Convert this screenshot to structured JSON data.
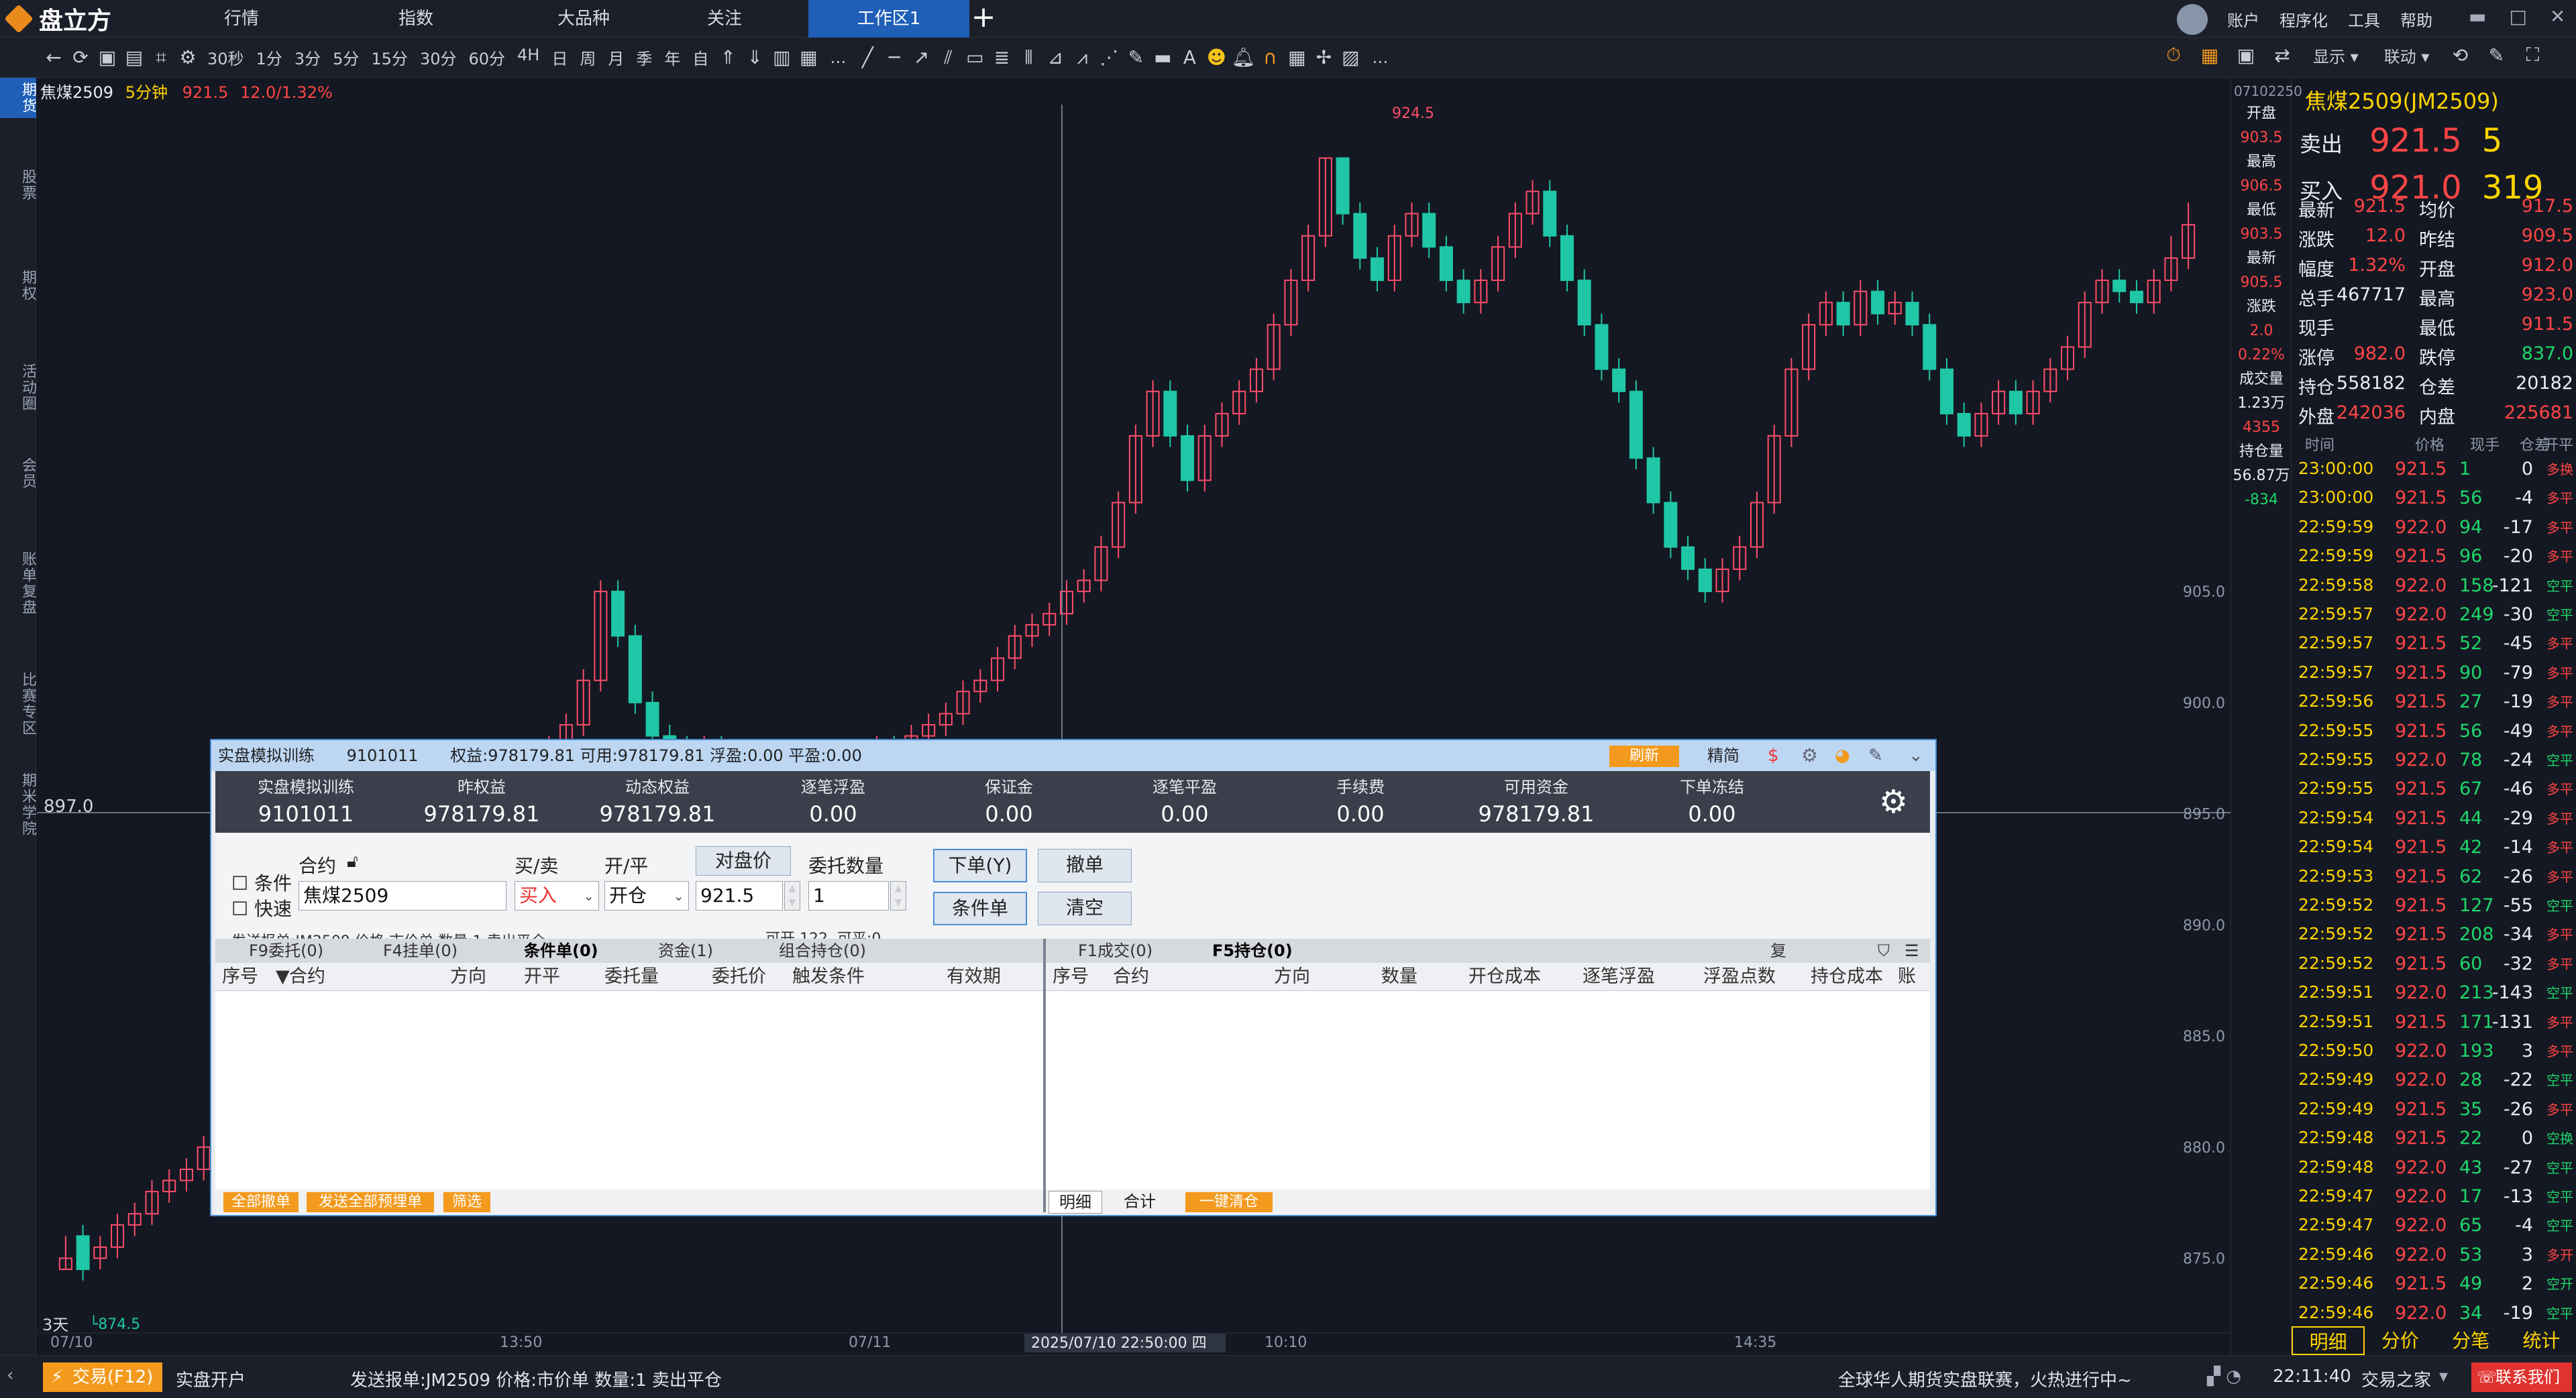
{
  "app": {
    "name": "盘立方"
  },
  "nav": {
    "tabs": [
      "行情",
      "指数",
      "大品种",
      "关注",
      "工作区1"
    ],
    "active_index": 4,
    "right_menu": [
      "账户",
      "程序化",
      "工具",
      "帮助"
    ]
  },
  "toolbar": {
    "periods": [
      "30秒",
      "1分",
      "3分",
      "5分",
      "15分",
      "30分",
      "60分",
      "4H",
      "日",
      "周",
      "月",
      "季",
      "年",
      "自"
    ],
    "right_items": [
      "显示",
      "联动"
    ]
  },
  "leftbar": {
    "items": [
      "期货",
      "股票",
      "期权",
      "活动圈",
      "会员",
      "账单复盘",
      "比赛专区",
      "期米学院"
    ],
    "active_index": 0
  },
  "chart": {
    "symbol": "焦煤2509",
    "period": "5分钟",
    "last": "921.5",
    "change": "12.0/1.32%",
    "high_label": "924.5",
    "low_label": "874.5",
    "cursor_price": "897.0",
    "cursor_time": "2025/07/10 22:50:00 四",
    "x_labels": [
      "07/10",
      "13:50",
      "07/11",
      "10:10",
      "14:35"
    ],
    "y_labels": [
      "905.0",
      "900.0",
      "895.0",
      "890.0",
      "885.0",
      "880.0",
      "875.0"
    ],
    "bottom_left": "3天",
    "side_info": [
      "开盘",
      "903.5",
      "最高",
      "906.5",
      "最低",
      "903.5",
      "最新",
      "905.5",
      "涨跌",
      "2.0",
      "0.22%",
      "成交量",
      "1.23万",
      "4355",
      "持仓量",
      "56.87万",
      "-834"
    ],
    "date_top": "07102250"
  },
  "quote": {
    "title": "焦煤2509(JM2509)",
    "sell_label": "卖出",
    "sell_price": "921.5",
    "sell_vol": "5",
    "buy_label": "买入",
    "buy_price": "921.0",
    "buy_vol": "319",
    "rows": [
      [
        "最新",
        "921.5",
        "均价",
        "917.5"
      ],
      [
        "涨跌",
        "12.0",
        "昨结",
        "909.5"
      ],
      [
        "幅度",
        "1.32%",
        "开盘",
        "912.0"
      ],
      [
        "总手",
        "467717",
        "最高",
        "923.0"
      ],
      [
        "现手",
        "",
        "最低",
        "911.5"
      ],
      [
        "涨停",
        "982.0",
        "跌停",
        "837.0"
      ],
      [
        "持仓",
        "558182",
        "仓差",
        "20182"
      ],
      [
        "外盘",
        "242036",
        "内盘",
        "225681"
      ]
    ],
    "ticks_header": [
      "时间",
      "价格",
      "现手",
      "仓差",
      "开平"
    ],
    "ticks": [
      [
        "23:00:00",
        "921.5",
        "1",
        "0",
        "多换"
      ],
      [
        "23:00:00",
        "921.5",
        "56",
        "-4",
        "多平"
      ],
      [
        "22:59:59",
        "922.0",
        "94",
        "-17",
        "多平"
      ],
      [
        "22:59:59",
        "921.5",
        "96",
        "-20",
        "多平"
      ],
      [
        "22:59:58",
        "922.0",
        "158",
        "-121",
        "空平"
      ],
      [
        "22:59:57",
        "922.0",
        "249",
        "-30",
        "空平"
      ],
      [
        "22:59:57",
        "921.5",
        "52",
        "-45",
        "多平"
      ],
      [
        "22:59:57",
        "921.5",
        "90",
        "-79",
        "多平"
      ],
      [
        "22:59:56",
        "921.5",
        "27",
        "-19",
        "多平"
      ],
      [
        "22:59:55",
        "921.5",
        "56",
        "-49",
        "多平"
      ],
      [
        "22:59:55",
        "922.0",
        "78",
        "-24",
        "空平"
      ],
      [
        "22:59:55",
        "921.5",
        "67",
        "-46",
        "多平"
      ],
      [
        "22:59:54",
        "921.5",
        "44",
        "-29",
        "多平"
      ],
      [
        "22:59:54",
        "921.5",
        "42",
        "-14",
        "多平"
      ],
      [
        "22:59:53",
        "921.5",
        "62",
        "-26",
        "多平"
      ],
      [
        "22:59:52",
        "921.5",
        "127",
        "-55",
        "空平"
      ],
      [
        "22:59:52",
        "921.5",
        "208",
        "-34",
        "多平"
      ],
      [
        "22:59:52",
        "921.5",
        "60",
        "-32",
        "多平"
      ],
      [
        "22:59:51",
        "922.0",
        "213",
        "-143",
        "空平"
      ],
      [
        "22:59:51",
        "921.5",
        "171",
        "-131",
        "多平"
      ],
      [
        "22:59:50",
        "922.0",
        "193",
        "3",
        "多平"
      ],
      [
        "22:59:49",
        "922.0",
        "28",
        "-22",
        "空平"
      ],
      [
        "22:59:49",
        "921.5",
        "35",
        "-26",
        "多平"
      ],
      [
        "22:59:48",
        "921.5",
        "22",
        "0",
        "空换"
      ],
      [
        "22:59:48",
        "922.0",
        "43",
        "-27",
        "空平"
      ],
      [
        "22:59:47",
        "922.0",
        "17",
        "-13",
        "空平"
      ],
      [
        "22:59:47",
        "922.0",
        "65",
        "-4",
        "空平"
      ],
      [
        "22:59:46",
        "922.0",
        "53",
        "3",
        "多开"
      ],
      [
        "22:59:46",
        "921.5",
        "49",
        "2",
        "空开"
      ],
      [
        "22:59:46",
        "922.0",
        "34",
        "-19",
        "空平"
      ]
    ],
    "bottom_tabs": [
      "明细",
      "分价",
      "分笔",
      "统计"
    ]
  },
  "order": {
    "title_account": "实盘模拟训练",
    "title_id": "9101011",
    "title_summary": "权益:978179.81 可用:978179.81 浮盈:0.00 平盈:0.00",
    "refresh": "刷新",
    "simple": "精简",
    "head": [
      [
        "实盘模拟训练",
        "9101011"
      ],
      [
        "昨权益",
        "978179.81"
      ],
      [
        "动态权益",
        "978179.81"
      ],
      [
        "逐笔浮盈",
        "0.00"
      ],
      [
        "保证金",
        "0.00"
      ],
      [
        "逐笔平盈",
        "0.00"
      ],
      [
        "手续费",
        "0.00"
      ],
      [
        "可用资金",
        "978179.81"
      ],
      [
        "下单冻结",
        "0.00"
      ]
    ],
    "cond_label": "条件",
    "fast_label": "快速",
    "contract_label": "合约",
    "contract_value": "焦煤2509",
    "bs_label": "买/卖",
    "bs_value": "买入",
    "oc_label": "开/平",
    "oc_value": "开仓",
    "price_btn": "对盘价",
    "price_value": "921.5",
    "qty_label": "委托数量",
    "qty_value": "1",
    "submit": "下单(Y)",
    "cond_order": "条件单",
    "cancel": "撤单",
    "clear": "清空",
    "hint": "发送报单:JM2509 价格:市价单 数量:1 卖出平仓",
    "can_open": "可开",
    "can_open_val": "122",
    "can_close": "可平:0",
    "left_tabs": [
      "F9委托(0)",
      "F4挂单(0)",
      "条件单(0)",
      "资金(1)",
      "组合持仓(0)"
    ],
    "left_cols": [
      "序号",
      "合约",
      "方向",
      "开平",
      "委托量",
      "委托价",
      "触发条件",
      "有效期"
    ],
    "right_tabs": [
      "F1成交(0)",
      "F5持仓(0)"
    ],
    "right_cols": [
      "序号",
      "合约",
      "方向",
      "数量",
      "开仓成本",
      "逐笔浮盈",
      "浮盈点数",
      "持仓成本",
      "账号"
    ],
    "copy": "复",
    "left_btns": [
      "全部撤单",
      "发送全部预埋单",
      "筛选"
    ],
    "right_btns": [
      "明细",
      "合计",
      "一键清仓"
    ]
  },
  "status": {
    "trade": "交易(F12)",
    "open_account": "实盘开户",
    "message": "发送报单:JM2509 价格:市价单 数量:1 卖出平仓",
    "marquee": "全球华人期货实盘联赛，火热进行中~",
    "time": "22:11:40",
    "trade_hall": "交易之家",
    "contact": "联系我们"
  },
  "candles": [
    [
      874.5,
      875,
      874.5,
      876
    ],
    [
      876,
      874.5,
      874,
      876.5
    ],
    [
      875,
      875.5,
      874.5,
      876
    ],
    [
      875.5,
      876.5,
      875,
      877
    ],
    [
      876.5,
      877,
      876,
      877.5
    ],
    [
      877,
      878,
      876.5,
      878.5
    ],
    [
      878,
      878.5,
      877.5,
      879
    ],
    [
      878.5,
      879,
      878,
      879.5
    ],
    [
      879,
      880,
      878.5,
      880.5
    ],
    [
      880,
      880.5,
      879.5,
      881
    ],
    [
      880.5,
      881,
      880,
      882
    ],
    [
      881,
      882,
      880.5,
      882.5
    ],
    [
      882,
      883,
      881.5,
      883.5
    ],
    [
      883,
      884,
      882.5,
      884.5
    ],
    [
      884,
      885,
      883.5,
      885.5
    ],
    [
      885,
      886,
      884.5,
      886.5
    ],
    [
      886,
      887,
      885.5,
      887.5
    ],
    [
      887,
      888,
      886.5,
      888.5
    ],
    [
      888,
      889,
      887.5,
      889.5
    ],
    [
      889,
      890,
      888.5,
      890.5
    ],
    [
      890,
      891,
      889.5,
      891.5
    ],
    [
      891,
      892,
      890.5,
      892.5
    ],
    [
      892,
      893,
      891.5,
      893.5
    ],
    [
      893,
      894,
      892.5,
      894.5
    ],
    [
      894,
      895,
      893.5,
      895.5
    ],
    [
      895,
      895.5,
      893.5,
      896
    ],
    [
      895.5,
      894.5,
      894,
      896
    ],
    [
      894.5,
      896,
      894,
      896.5
    ],
    [
      896,
      898,
      895.5,
      898.5
    ],
    [
      898,
      899,
      897.5,
      899.5
    ],
    [
      899,
      901,
      898.5,
      901.5
    ],
    [
      901,
      905,
      900.5,
      905.5
    ],
    [
      905,
      903,
      902.5,
      905.5
    ],
    [
      903,
      900,
      899.5,
      903.5
    ],
    [
      900,
      898.5,
      898,
      900.5
    ],
    [
      898.5,
      898,
      897.5,
      899
    ],
    [
      898,
      897.5,
      897,
      898.5
    ],
    [
      897.5,
      898,
      897,
      898.5
    ],
    [
      898,
      897,
      896.5,
      898.5
    ],
    [
      897,
      896.5,
      896,
      897.5
    ],
    [
      896.5,
      895.5,
      895,
      897
    ],
    [
      895.5,
      896,
      895,
      896.5
    ],
    [
      896,
      895.5,
      895,
      896.5
    ],
    [
      895.5,
      895,
      894.5,
      896
    ],
    [
      895,
      895.5,
      894.5,
      896
    ],
    [
      895.5,
      896,
      895,
      896.5
    ],
    [
      896,
      897,
      895.5,
      897.5
    ],
    [
      897,
      898,
      896.5,
      898.5
    ],
    [
      898,
      897.5,
      897,
      898.5
    ],
    [
      897.5,
      898.5,
      897,
      899
    ],
    [
      898.5,
      899,
      898,
      899.5
    ],
    [
      899,
      899.5,
      898.5,
      900
    ],
    [
      899.5,
      900.5,
      899,
      901
    ],
    [
      900.5,
      901,
      900,
      901.5
    ],
    [
      901,
      902,
      900.5,
      902.5
    ],
    [
      902,
      903,
      901.5,
      903.5
    ],
    [
      903,
      903.5,
      902.5,
      904
    ],
    [
      903.5,
      904,
      903,
      904.5
    ],
    [
      904,
      905,
      903.5,
      905.5
    ],
    [
      905,
      905.5,
      904.5,
      906
    ],
    [
      905.5,
      907,
      905,
      907.5
    ],
    [
      907,
      909,
      906.5,
      909.5
    ],
    [
      909,
      912,
      908.5,
      912.5
    ],
    [
      912,
      914,
      911.5,
      914.5
    ],
    [
      914,
      912,
      911.5,
      914.5
    ],
    [
      912,
      910,
      909.5,
      912.5
    ],
    [
      910,
      912,
      909.5,
      912.5
    ],
    [
      912,
      913,
      911.5,
      913.5
    ],
    [
      913,
      914,
      912.5,
      914.5
    ],
    [
      914,
      915,
      913.5,
      915.5
    ],
    [
      915,
      917,
      914.5,
      917.5
    ],
    [
      917,
      919,
      916.5,
      919.5
    ],
    [
      919,
      921,
      918.5,
      921.5
    ],
    [
      921,
      924.5,
      920.5,
      924.5
    ],
    [
      924.5,
      922,
      921.5,
      924.5
    ],
    [
      922,
      920,
      919.5,
      922.5
    ],
    [
      920,
      919,
      918.5,
      920.5
    ],
    [
      919,
      921,
      918.5,
      921.5
    ],
    [
      921,
      922,
      920.5,
      922.5
    ],
    [
      922,
      920.5,
      920,
      922.5
    ],
    [
      920.5,
      919,
      918.5,
      921
    ],
    [
      919,
      918,
      917.5,
      919.5
    ],
    [
      918,
      919,
      917.5,
      919.5
    ],
    [
      919,
      920.5,
      918.5,
      921
    ],
    [
      920.5,
      922,
      920,
      922.5
    ],
    [
      922,
      923,
      921.5,
      923.5
    ],
    [
      923,
      921,
      920.5,
      923.5
    ],
    [
      921,
      919,
      918.5,
      921.5
    ],
    [
      919,
      917,
      916.5,
      919.5
    ],
    [
      917,
      915,
      914.5,
      917.5
    ],
    [
      915,
      914,
      913.5,
      915.5
    ],
    [
      914,
      911,
      910.5,
      914.5
    ],
    [
      911,
      909,
      908.5,
      911.5
    ],
    [
      909,
      907,
      906.5,
      909.5
    ],
    [
      907,
      906,
      905.5,
      907.5
    ],
    [
      906,
      905,
      904.5,
      906.5
    ],
    [
      905,
      906,
      904.5,
      906.5
    ],
    [
      906,
      907,
      905.5,
      907.5
    ],
    [
      907,
      909,
      906.5,
      909.5
    ],
    [
      909,
      912,
      908.5,
      912.5
    ],
    [
      912,
      915,
      911.5,
      915.5
    ],
    [
      915,
      917,
      914.5,
      917.5
    ],
    [
      917,
      918,
      916.5,
      918.5
    ],
    [
      918,
      917,
      916.5,
      918.5
    ],
    [
      917,
      918.5,
      916.5,
      919
    ],
    [
      918.5,
      917.5,
      917,
      919
    ],
    [
      917.5,
      918,
      917,
      918.5
    ],
    [
      918,
      917,
      916.5,
      918.5
    ],
    [
      917,
      915,
      914.5,
      917.5
    ],
    [
      915,
      913,
      912.5,
      915.5
    ],
    [
      913,
      912,
      911.5,
      913.5
    ],
    [
      912,
      913,
      911.5,
      913.5
    ],
    [
      913,
      914,
      912.5,
      914.5
    ],
    [
      914,
      913,
      912.5,
      914.5
    ],
    [
      913,
      914,
      912.5,
      914.5
    ],
    [
      914,
      915,
      913.5,
      915.5
    ],
    [
      915,
      916,
      914.5,
      916.5
    ],
    [
      916,
      918,
      915.5,
      918.5
    ],
    [
      918,
      919,
      917.5,
      919.5
    ],
    [
      919,
      918.5,
      918,
      919.5
    ],
    [
      918.5,
      918,
      917.5,
      919
    ],
    [
      918,
      919,
      917.5,
      919.5
    ],
    [
      919,
      920,
      918.5,
      921
    ],
    [
      920,
      921.5,
      919.5,
      922.5
    ]
  ]
}
